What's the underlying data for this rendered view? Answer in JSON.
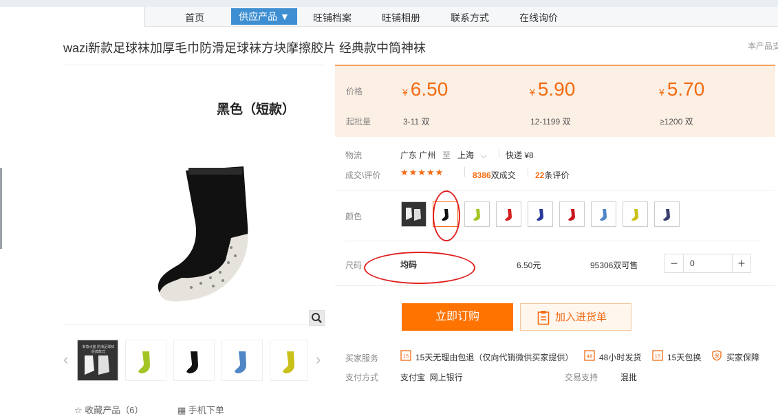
{
  "nav": {
    "items": [
      "首页",
      "旺铺档案",
      "旺铺相册",
      "联系方式",
      "在线询价"
    ],
    "active": "供应产品 ▼"
  },
  "product": {
    "title": "wazi新款足球袜加厚毛巾防滑足球袜方块摩擦胶片 经典款中筒神袜",
    "right_note": "本产品支"
  },
  "gallery": {
    "caption": "黑色（短款）",
    "zoom_icon": "magnifier-icon",
    "thumb_first_caption": "新款点胶 防滑足球袜\n经典款式"
  },
  "pricing": {
    "price_label": "价格",
    "moq_label": "起批量",
    "currency": "¥",
    "tiers": [
      {
        "price": "6.50",
        "moq": "3-11 双"
      },
      {
        "price": "5.90",
        "moq": "12-1199 双"
      },
      {
        "price": "5.70",
        "moq": "≥1200 双"
      }
    ]
  },
  "logistics": {
    "label": "物流",
    "from": "广东 广州",
    "to_word": "至",
    "to": "上海",
    "shipping": "快递 ¥8"
  },
  "reviews": {
    "label": "成交\\评价",
    "stars": "★★★★★",
    "deals_count": "8386",
    "deals_suffix": "双成交",
    "reviews_count": "22",
    "reviews_suffix": "条评价"
  },
  "color": {
    "label": "颜色"
  },
  "size": {
    "label": "尺码",
    "value": "均码",
    "price": "6.50元",
    "stock": "95306双可售",
    "quantity": "0"
  },
  "actions": {
    "buy": "立即订购",
    "cart": "加入进货单"
  },
  "service": {
    "label": "买家服务",
    "items": [
      "15天无理由包退（仅向代销微供买家提供）",
      "48小时发货",
      "15天包换",
      "买家保障"
    ]
  },
  "payment": {
    "label": "支付方式",
    "methods": "支付宝  网上银行",
    "trade_label": "交易支持",
    "trade_value": "混批"
  },
  "footer": {
    "fav": "收藏产品（6）",
    "mobile": "手机下单"
  },
  "colors": {
    "accent": "#f26b12",
    "nav_active": "#3d8fd1",
    "buy_button": "#ff7300",
    "price_bg": "#fcefe4",
    "annotation": "#e02020",
    "swatch_sock_colors": [
      "#111111",
      "#a3c524",
      "#d42020",
      "#2a3a9a",
      "#c8161d",
      "#4f86c6",
      "#c9c11a",
      "#3a3f6e"
    ]
  }
}
